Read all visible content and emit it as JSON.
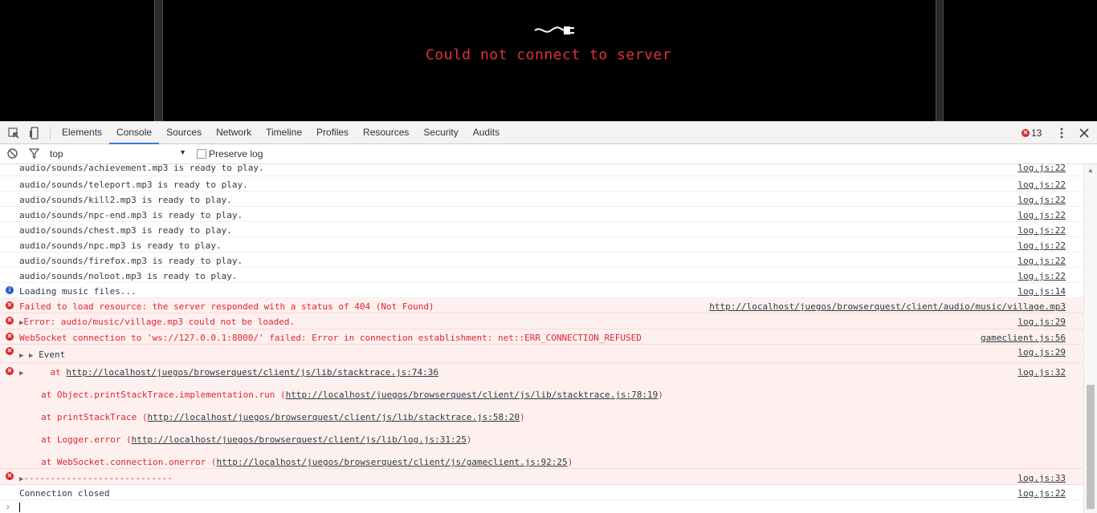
{
  "game": {
    "error_message": "Could not connect to server"
  },
  "devtools": {
    "tabs": [
      "Elements",
      "Console",
      "Sources",
      "Network",
      "Timeline",
      "Profiles",
      "Resources",
      "Security",
      "Audits"
    ],
    "active_tab": "Console",
    "error_count": "13"
  },
  "toolbar": {
    "context": "top",
    "preserve_log": "Preserve log"
  },
  "log": {
    "r1": {
      "text": "audio/sounds/achievement.mp3 is ready to play.",
      "src": "log.js:22"
    },
    "r2": {
      "text": "audio/sounds/teleport.mp3 is ready to play.",
      "src": "log.js:22"
    },
    "r3": {
      "text": "audio/sounds/kill2.mp3 is ready to play.",
      "src": "log.js:22"
    },
    "r4": {
      "text": "audio/sounds/npc-end.mp3 is ready to play.",
      "src": "log.js:22"
    },
    "r5": {
      "text": "audio/sounds/chest.mp3 is ready to play.",
      "src": "log.js:22"
    },
    "r6": {
      "text": "audio/sounds/npc.mp3 is ready to play.",
      "src": "log.js:22"
    },
    "r7": {
      "text": "audio/sounds/firefox.mp3 is ready to play.",
      "src": "log.js:22"
    },
    "r8": {
      "text": "audio/sounds/noloot.mp3 is ready to play.",
      "src": "log.js:22"
    },
    "r9": {
      "text": "Loading music files...",
      "src": "log.js:14"
    },
    "r10": {
      "text": "Failed to load resource: the server responded with a status of 404 (Not Found)",
      "src": "http://localhost/juegos/browserquest/client/audio/music/village.mp3"
    },
    "r11": {
      "text": "Error: audio/music/village.mp3 could not be loaded.",
      "src": "log.js:29"
    },
    "r12": {
      "text": "WebSocket connection to 'ws://127.0.0.1:8000/' failed: Error in connection establishment: net::ERR_CONNECTION_REFUSED",
      "src": "gameclient.js:56"
    },
    "r13": {
      "text": "Event",
      "src": "log.js:29"
    },
    "r14": {
      "at": "at ",
      "first_link": "http://localhost/juegos/browserquest/client/js/lib/stacktrace.js:74:36",
      "src": "log.js:32",
      "s1_pre": "at Object.printStackTrace.implementation.run (",
      "s1_link": "http://localhost/juegos/browserquest/client/js/lib/stacktrace.js:78:19",
      "s2_pre": "at printStackTrace (",
      "s2_link": "http://localhost/juegos/browserquest/client/js/lib/stacktrace.js:58:20",
      "s3_pre": "at Logger.error (",
      "s3_link": "http://localhost/juegos/browserquest/client/js/lib/log.js:31:25",
      "s4_pre": "at WebSocket.connection.onerror (",
      "s4_link": "http://localhost/juegos/browserquest/client/js/gameclient.js:92:25",
      "close": ")"
    },
    "r15": {
      "text": "----------------------------",
      "src": "log.js:33"
    },
    "r16": {
      "text": "Connection closed",
      "src": "log.js:22"
    }
  },
  "colors": {
    "error": "#e0262b",
    "error_bg": "#fff0f0",
    "accent": "#3879d9",
    "game_error": "#e0303a"
  }
}
